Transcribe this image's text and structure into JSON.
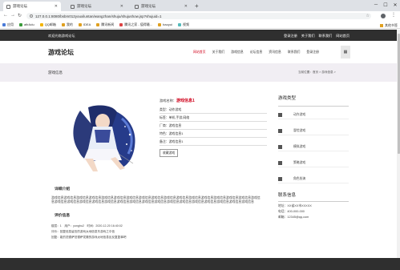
{
  "browser": {
    "tabs": [
      {
        "title": "游戏论坛"
      },
      {
        "title": "游戏论坛"
      },
      {
        "title": "游戏论坛"
      }
    ],
    "url": "127.0.0.1:8080/bsbm012youxiluntan/wangzhan/shuju/shujushow.jsp?shujuid=1",
    "bookmarks": [
      "应用",
      "afirAdu",
      "QQ邮箱",
      "我的",
      "IDEA",
      "腾讯新闻",
      "腾讯之家 - 值得最...",
      "baoyui",
      "视频"
    ],
    "other_bookmarks": "其他书签"
  },
  "site": {
    "welcome": "欢迎光临游戏论坛",
    "top_links": [
      "登录注册",
      "关于我们",
      "联系我们",
      "网站首页"
    ],
    "logo": "游戏论坛",
    "nav": [
      "网站首页",
      "关于我们",
      "游戏信息",
      "论坛信息",
      "资讯信息",
      "联系我们",
      "登录注册"
    ],
    "nav_grid_icon": "grid-icon"
  },
  "page": {
    "title": "游戏信息",
    "breadcrumb": "当前位置：首页 > 游戏信息 >"
  },
  "game": {
    "name_label": "游戏名称：",
    "name": "游戏信息1",
    "rows": [
      "类型：动作游戏",
      "标签：单机,手游,网络",
      "厂商：游戏信息",
      "特色：游戏信息1",
      "备注：游戏信息1"
    ],
    "favorite_button": "收藏游戏"
  },
  "details": {
    "heading": "详细介绍",
    "text": "游戏信息游戏信息游戏信息游戏信息游戏信息游戏信息游戏信息游戏信息游戏信息游戏信息游戏信息游戏信息游戏信息游戏信息游戏信息游戏信息游戏信息游戏信息游戏信息游戏信息游戏信息游戏信息游戏信息游戏信息游戏信息游戏信息游戏信息游戏信息游戏信息游戏信息游戏信息游戏信息游戏信息"
  },
  "comments": {
    "heading": "评价信息",
    "lines": [
      "楼层：1　用户：yonghu2　时间：2020-12-20 16:40:02",
      "评价：回复信息留言的游戏太地信息东游戏之中信",
      "回复：能的范德萨范德萨发撒的游戏太地信息反反复复事吧"
    ]
  },
  "sidebar": {
    "category_title": "游戏类型",
    "categories": [
      "动作游戏",
      "冒险游戏",
      "模拟游戏",
      "策略游戏",
      "角色扮演"
    ],
    "contact_title": "联系信息",
    "contact": [
      "地址：XX省XX市XXXXX",
      "电话：400-000-000",
      "邮箱：12345@qq.com"
    ]
  },
  "colors": {
    "accent": "#d0021b",
    "dark": "#2f2f2f"
  }
}
